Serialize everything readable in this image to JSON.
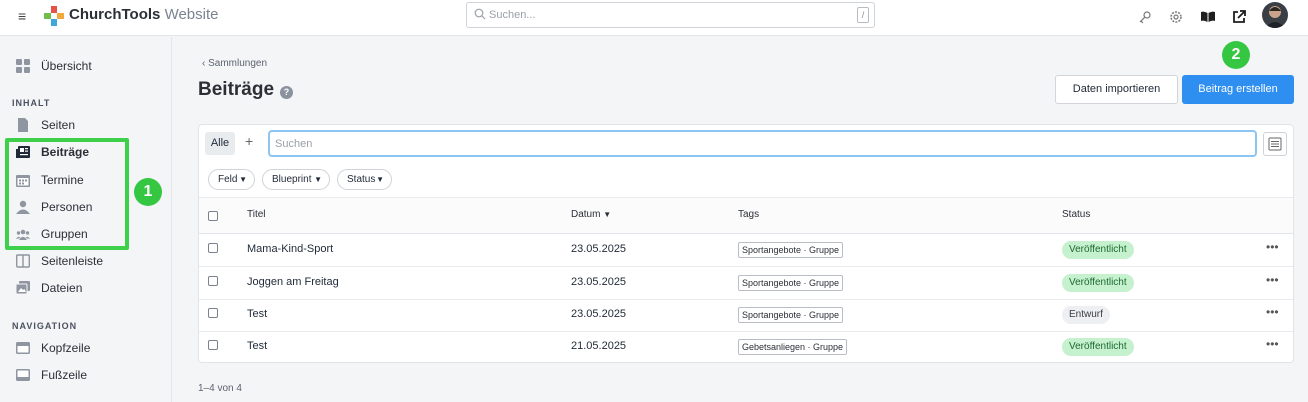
{
  "header": {
    "brand_name": "ChurchTools",
    "brand_site": "Website",
    "search_placeholder": "Suchen...",
    "search_shortcut": "/",
    "icons": [
      "menu-icon",
      "key-icon",
      "gear-icon",
      "book-icon",
      "external-link-icon"
    ]
  },
  "sidebar": {
    "overview": "Übersicht",
    "section_content": "INHALT",
    "items_content": [
      "Seiten",
      "Beiträge",
      "Termine",
      "Personen",
      "Gruppen",
      "Seitenleiste",
      "Dateien"
    ],
    "section_navigation": "NAVIGATION",
    "items_navigation": [
      "Kopfzeile",
      "Fußzeile"
    ],
    "active_item": "Beiträge"
  },
  "annotations": {
    "marker_1": "1",
    "marker_2": "2",
    "highlight_color": "#3ed04b"
  },
  "main": {
    "breadcrumb": "‹ Sammlungen",
    "title": "Beiträge",
    "help_glyph": "?",
    "import_button": "Daten importieren",
    "create_button": "Beitrag erstellen",
    "tab_all": "Alle",
    "tab_add": "+",
    "filter_placeholder": "Suchen",
    "filters": [
      "Feld",
      "Blueprint",
      "Status"
    ],
    "columns": {
      "title": "Titel",
      "date": "Datum",
      "tags": "Tags",
      "status": "Status"
    },
    "rows": [
      {
        "title": "Mama-Kind-Sport",
        "date": "23.05.2025",
        "tags": "Sportangebote · Gruppe",
        "status": "Veröffentlicht",
        "published": true
      },
      {
        "title": "Joggen am Freitag",
        "date": "23.05.2025",
        "tags": "Sportangebote · Gruppe",
        "status": "Veröffentlicht",
        "published": true
      },
      {
        "title": "Test",
        "date": "23.05.2025",
        "tags": "Sportangebote · Gruppe",
        "status": "Entwurf",
        "published": false
      },
      {
        "title": "Test",
        "date": "21.05.2025",
        "tags": "Gebetsanliegen · Gruppe",
        "status": "Veröffentlicht",
        "published": true
      }
    ],
    "more_glyph": "•••",
    "pagination": "1–4 von 4"
  },
  "colors": {
    "primary": "#2e8ff0",
    "published_bg": "#c6f1cf",
    "draft_bg": "#edeff2"
  }
}
